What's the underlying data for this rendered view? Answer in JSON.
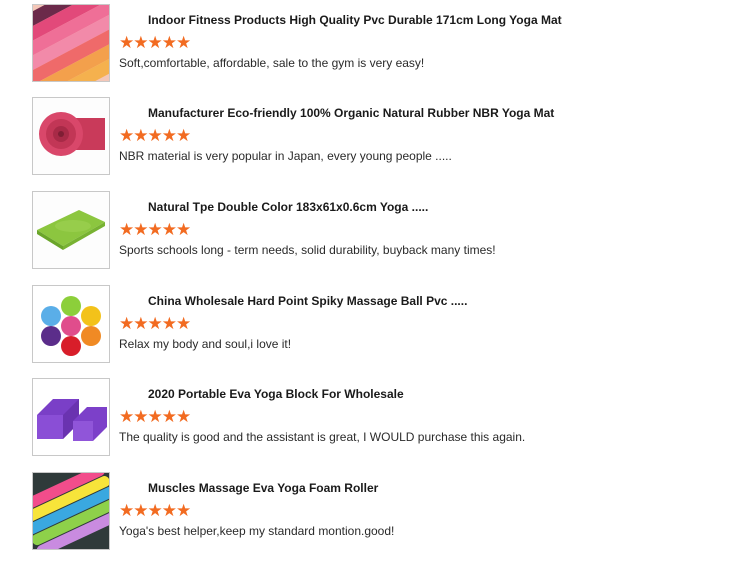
{
  "reviews": [
    {
      "title": "Indoor Fitness Products High Quality Pvc Durable 171cm Long Yoga Mat",
      "stars": "★★★★★",
      "rating": 5,
      "comment": "Soft,comfortable, affordable, sale to the gym is very easy!"
    },
    {
      "title": "Manufacturer Eco-friendly 100% Organic Natural Rubber NBR Yoga Mat",
      "stars": "★★★★★",
      "rating": 5,
      "comment": "NBR material is very popular in Japan, every young people ....."
    },
    {
      "title": "Natural Tpe Double Color 183x61x0.6cm Yoga .....",
      "stars": "★★★★★",
      "rating": 5,
      "comment": "Sports schools long - term needs, solid durability, buyback many times!"
    },
    {
      "title": "China Wholesale Hard Point Spiky Massage Ball Pvc .....",
      "stars": "★★★★★",
      "rating": 5,
      "comment": "Relax my body and soul,i love it!"
    },
    {
      "title": "2020 Portable Eva Yoga Block For Wholesale",
      "stars": "★★★★★",
      "rating": 5,
      "comment": "The quality is good and the assistant is great, I WOULD purchase this again."
    },
    {
      "title": "Muscles Massage Eva Yoga Foam Roller",
      "stars": "★★★★★",
      "rating": 5,
      "comment": "Yoga's best helper,keep my standard montion.good!"
    }
  ],
  "colors": {
    "star": "#f26b21"
  }
}
